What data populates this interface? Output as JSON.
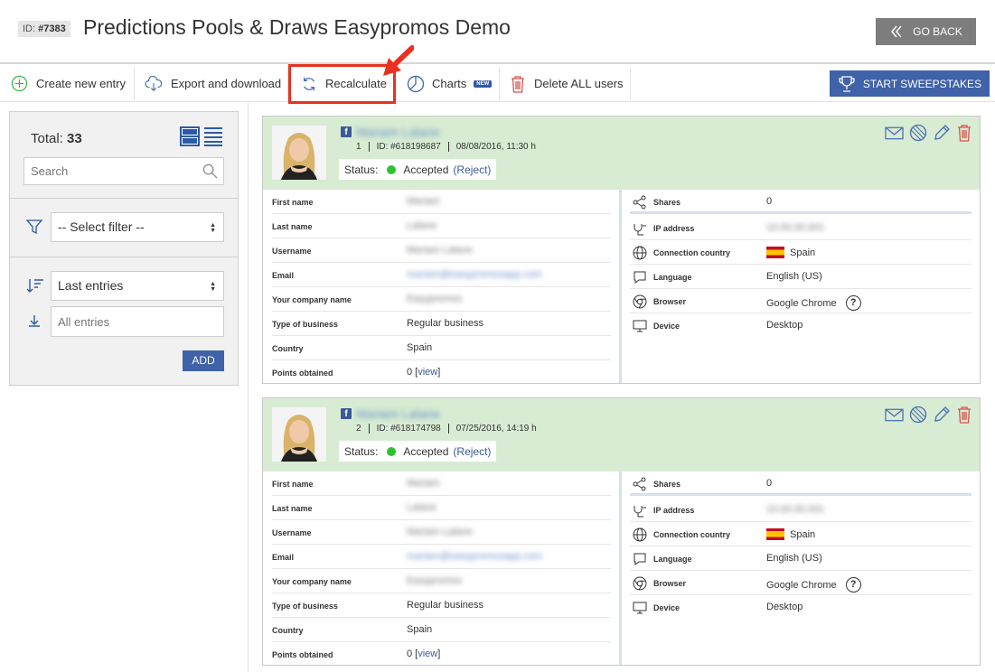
{
  "header": {
    "id_prefix": "ID:",
    "id_value": "#7383",
    "title": "Predictions Pools & Draws Easypromos Demo",
    "go_back": "GO BACK"
  },
  "toolbar": {
    "create": "Create new entry",
    "export": "Export and download",
    "recalculate": "Recalculate",
    "charts": "Charts",
    "charts_badge": "NEW",
    "delete_all": "Delete ALL users",
    "start": "START SWEEPSTAKES"
  },
  "sidebar": {
    "total_label": "Total:",
    "total_value": "33",
    "search_placeholder": "Search",
    "filter_select": "-- Select filter --",
    "order_select": "Last entries",
    "entries_placeholder": "All entries",
    "add": "ADD"
  },
  "entries": [
    {
      "name": "Mariam Lalane",
      "number": "1",
      "id": "ID: #618198687",
      "date": "08/08/2016, 11:30 h",
      "status_label": "Status:",
      "status": "Accepted",
      "reject": "(Reject)",
      "fields": [
        {
          "label": "First name",
          "value": "Mariam"
        },
        {
          "label": "Last name",
          "value": "Lalane"
        },
        {
          "label": "Username",
          "value": "Mariam Lalane"
        },
        {
          "label": "Email",
          "value": "mariam@easypromosapp.com"
        },
        {
          "label": "Your company name",
          "value": "Easypromos"
        },
        {
          "label": "Type of business",
          "value": "Regular business"
        },
        {
          "label": "Country",
          "value": "Spain"
        },
        {
          "label": "Points obtained",
          "value": "0 [",
          "link": "view",
          "suffix": "]"
        }
      ],
      "info": [
        {
          "label": "Shares",
          "value": "0"
        },
        {
          "label": "IP address",
          "value": "10.00.00.001"
        },
        {
          "label": "Connection country",
          "value": "Spain"
        },
        {
          "label": "Language",
          "value": "English (US)"
        },
        {
          "label": "Browser",
          "value": "Google Chrome"
        },
        {
          "label": "Device",
          "value": "Desktop"
        }
      ]
    },
    {
      "name": "Mariam Lalane",
      "number": "2",
      "id": "ID: #618174798",
      "date": "07/25/2016, 14:19 h",
      "status_label": "Status:",
      "status": "Accepted",
      "reject": "(Reject)",
      "fields": [
        {
          "label": "First name",
          "value": "Mariam"
        },
        {
          "label": "Last name",
          "value": "Lalane"
        },
        {
          "label": "Username",
          "value": "Mariam Lalane"
        },
        {
          "label": "Email",
          "value": "mariam@easypromosapp.com"
        },
        {
          "label": "Your company name",
          "value": "Easypromos"
        },
        {
          "label": "Type of business",
          "value": "Regular business"
        },
        {
          "label": "Country",
          "value": "Spain"
        },
        {
          "label": "Points obtained",
          "value": "0 [",
          "link": "view",
          "suffix": "]"
        }
      ],
      "info": [
        {
          "label": "Shares",
          "value": "0"
        },
        {
          "label": "IP address",
          "value": "10.00.00.001"
        },
        {
          "label": "Connection country",
          "value": "Spain"
        },
        {
          "label": "Language",
          "value": "English (US)"
        },
        {
          "label": "Browser",
          "value": "Google Chrome"
        },
        {
          "label": "Device",
          "value": "Desktop"
        }
      ]
    }
  ],
  "colors": {
    "primary": "#3f62a8",
    "highlight": "#e8321f",
    "accepted": "#2ec12e",
    "card_header": "#d8ecd3"
  }
}
